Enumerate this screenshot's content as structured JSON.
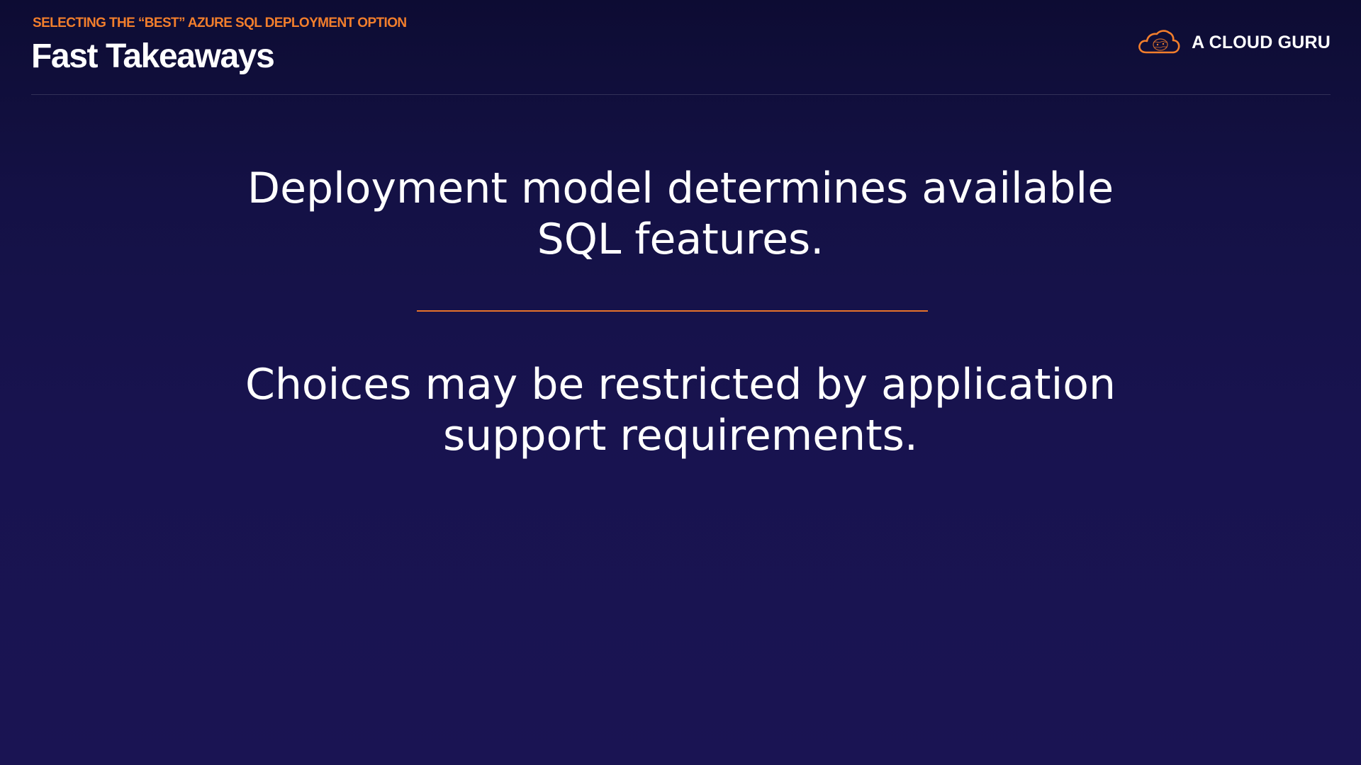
{
  "header": {
    "eyebrow": "SELECTING THE “BEST” AZURE SQL DEPLOYMENT OPTION",
    "title": "Fast Takeaways"
  },
  "brand": {
    "name": "A CLOUD GURU",
    "icon": "cloud-logo-icon",
    "accent_color": "#f27e2c"
  },
  "takeaways": [
    {
      "lines": [
        "Deployment model determines available",
        "SQL features."
      ]
    },
    {
      "lines": [
        "Choices may be restricted by application",
        "support requirements."
      ]
    }
  ],
  "colors": {
    "background_top": "#0d0c33",
    "background_bottom": "#1a1453",
    "accent_rule": "#e6732b"
  }
}
